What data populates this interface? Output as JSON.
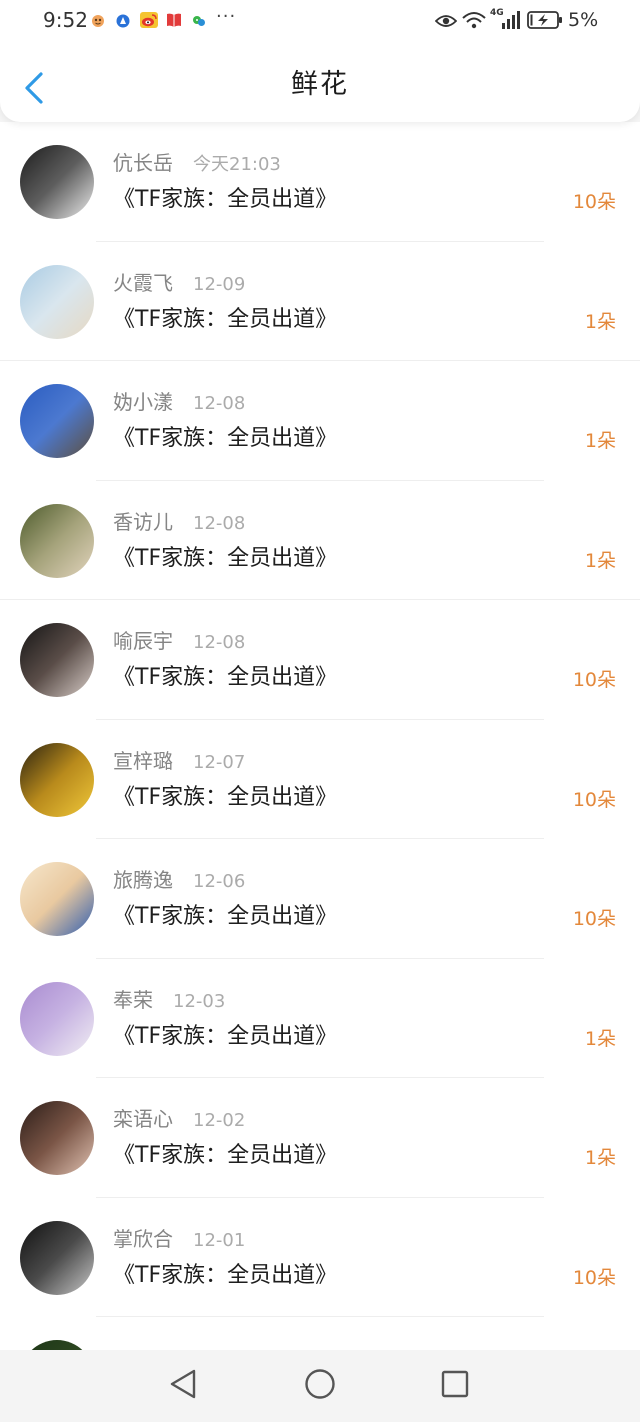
{
  "status_bar": {
    "time": "9:52",
    "app_icons": [
      "app-notification-icon",
      "blue-app-icon",
      "weibo-icon",
      "book-app-icon",
      "green-app-icon"
    ],
    "more": "···",
    "indicators": [
      "eye-icon",
      "wifi-icon",
      "signal-icon",
      "battery-charging-icon"
    ],
    "network": "4G",
    "battery": "5%"
  },
  "header": {
    "back_icon": "chevron-left-icon",
    "title": "鲜花"
  },
  "theme": {
    "accent": "#2f9ae6",
    "count_color": "#e3883b"
  },
  "list": {
    "items": [
      {
        "name": "伉长岳",
        "date": "今天21:03",
        "book": "《TF家族：全员出道》",
        "count": "10朵",
        "avatar_colors": [
          "#1c1c1c",
          "#5e5e5e",
          "#ededed"
        ]
      },
      {
        "name": "火霞飞",
        "date": "12-09",
        "book": "《TF家族：全员出道》",
        "count": "1朵",
        "avatar_colors": [
          "#a9cbe3",
          "#d9e6ee",
          "#e6d8c2"
        ]
      },
      {
        "name": "妫小漾",
        "date": "12-08",
        "book": "《TF家族：全员出道》",
        "count": "1朵",
        "avatar_colors": [
          "#2a5cc0",
          "#4c79d0",
          "#5e4f3c"
        ]
      },
      {
        "name": "香访儿",
        "date": "12-08",
        "book": "《TF家族：全员出道》",
        "count": "1朵",
        "avatar_colors": [
          "#4d5b2c",
          "#a4a27a",
          "#e2d4bd"
        ]
      },
      {
        "name": "喻辰宇",
        "date": "12-08",
        "book": "《TF家族：全员出道》",
        "count": "10朵",
        "avatar_colors": [
          "#141414",
          "#5a4d48",
          "#d8cdc8"
        ]
      },
      {
        "name": "宣梓璐",
        "date": "12-07",
        "book": "《TF家族：全员出道》",
        "count": "10朵",
        "avatar_colors": [
          "#2a2210",
          "#b88a1c",
          "#f0c83a"
        ]
      },
      {
        "name": "旅腾逸",
        "date": "12-06",
        "book": "《TF家族：全员出道》",
        "count": "10朵",
        "avatar_colors": [
          "#f6e7cc",
          "#e9c9a0",
          "#2f5db0"
        ]
      },
      {
        "name": "奉荣",
        "date": "12-03",
        "book": "《TF家族：全员出道》",
        "count": "1朵",
        "avatar_colors": [
          "#a98bd0",
          "#c6b2e2",
          "#f1eef3"
        ]
      },
      {
        "name": "栾语心",
        "date": "12-02",
        "book": "《TF家族：全员出道》",
        "count": "1朵",
        "avatar_colors": [
          "#2b1d18",
          "#7a5546",
          "#e0c2b2"
        ]
      },
      {
        "name": "掌欣合",
        "date": "12-01",
        "book": "《TF家族：全员出道》",
        "count": "10朵",
        "avatar_colors": [
          "#111111",
          "#4a4a4a",
          "#c8c8c8"
        ]
      },
      {
        "avatar_colors": [
          "#1c3416",
          "#3e5b2c"
        ]
      }
    ]
  },
  "nav_bar": {
    "back_icon": "triangle-back-icon",
    "home_icon": "circle-home-icon",
    "recents_icon": "square-recents-icon"
  }
}
